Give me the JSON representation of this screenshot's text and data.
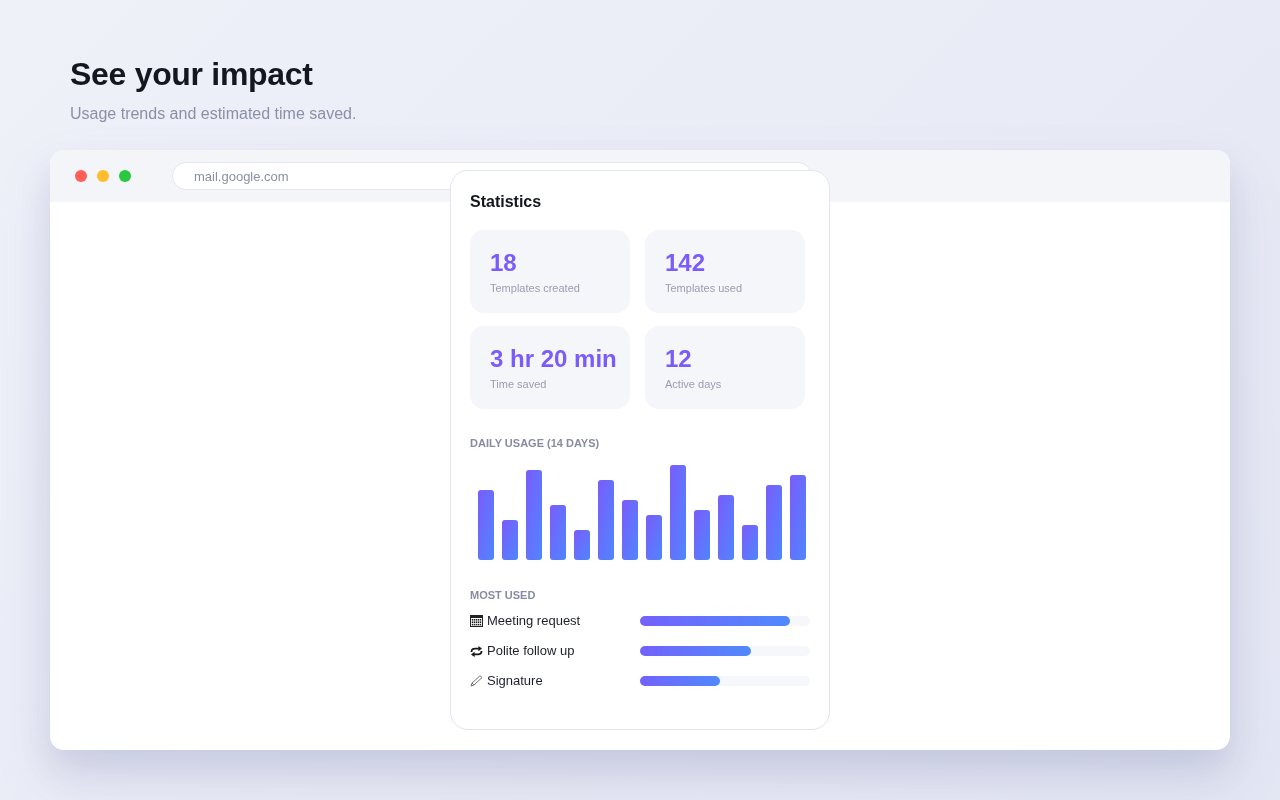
{
  "header": {
    "title": "See your impact",
    "subtitle": "Usage trends and estimated time saved."
  },
  "browser": {
    "address": "mail.google.com"
  },
  "statistics": {
    "title": "Statistics",
    "tiles": [
      {
        "value": "18",
        "label": "Templates created"
      },
      {
        "value": "142",
        "label": "Templates used"
      },
      {
        "value": "3 hr 20 min",
        "label": "Time saved"
      },
      {
        "value": "12",
        "label": "Active days"
      }
    ],
    "daily_usage": {
      "heading": "DAILY USAGE (14 DAYS)"
    },
    "most_used": {
      "heading": "MOST USED",
      "items": [
        {
          "name": "Meeting request",
          "level": 0.88
        },
        {
          "name": "Polite follow up",
          "level": 0.65
        },
        {
          "name": "Signature",
          "level": 0.47
        }
      ]
    }
  }
}
